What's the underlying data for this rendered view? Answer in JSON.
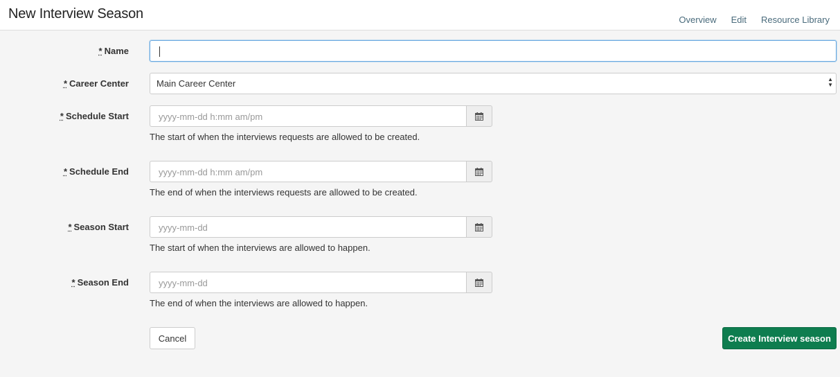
{
  "header": {
    "title": "New Interview Season",
    "nav": [
      "Overview",
      "Edit",
      "Resource Library"
    ]
  },
  "form": {
    "required_marker": "*",
    "name": {
      "label": "Name",
      "value": ""
    },
    "career_center": {
      "label": "Career Center",
      "selected": "Main Career Center"
    },
    "schedule_start": {
      "label": "Schedule Start",
      "placeholder": "yyyy-mm-dd h:mm am/pm",
      "help": "The start of when the interviews requests are allowed to be created."
    },
    "schedule_end": {
      "label": "Schedule End",
      "placeholder": "yyyy-mm-dd h:mm am/pm",
      "help": "The end of when the interviews requests are allowed to be created."
    },
    "season_start": {
      "label": "Season Start",
      "placeholder": "yyyy-mm-dd",
      "help": "The start of when the interviews are allowed to happen."
    },
    "season_end": {
      "label": "Season End",
      "placeholder": "yyyy-mm-dd",
      "help": "The end of when the interviews are allowed to happen."
    }
  },
  "actions": {
    "cancel": "Cancel",
    "create": "Create Interview season"
  },
  "colors": {
    "primary_button": "#0e7d4f",
    "link": "#4a6b7c",
    "background": "#f5f5f5"
  }
}
